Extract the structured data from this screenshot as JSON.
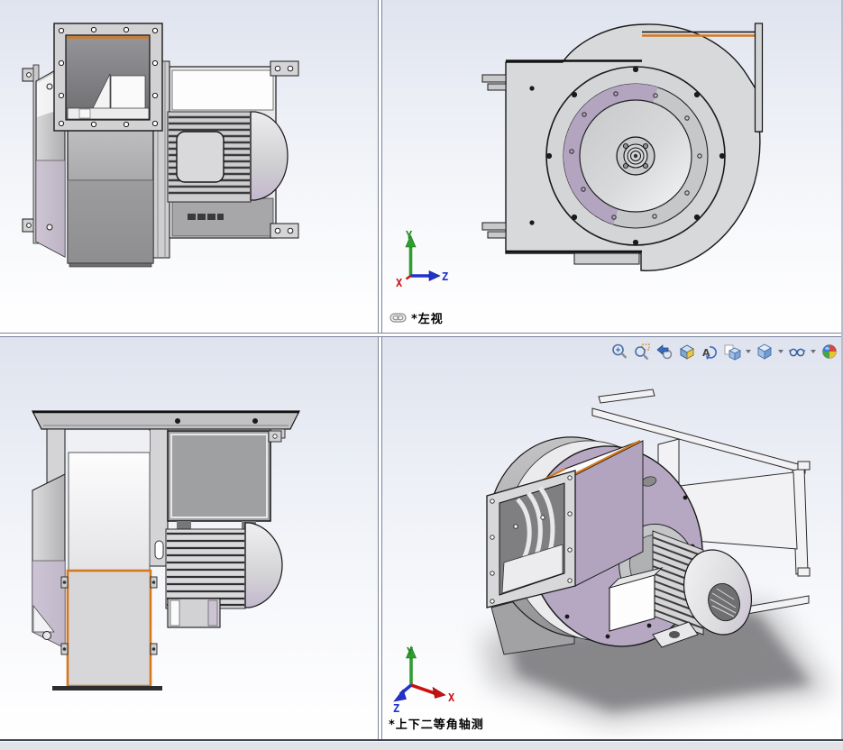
{
  "viewport_labels": {
    "top_right": "*左视",
    "bottom_right": "*上下二等角轴测"
  },
  "triad": {
    "x": "X",
    "y": "Y",
    "z": "Z"
  },
  "toolbar": {
    "items": [
      "zoom-to-fit-icon",
      "zoom-to-area-icon",
      "previous-view-icon",
      "section-view-icon",
      "rotate-view-icon",
      "view-orientation-icon",
      "display-style-icon",
      "hide-show-items-icon",
      "apply-scene-icon"
    ],
    "dropdown_items": [
      "view-orientation-icon",
      "display-style-icon",
      "hide-show-items-icon"
    ]
  },
  "colors": {
    "edge_highlight_orange": "#d4781e",
    "housing_lavender": "#b4a6c1",
    "axis_x_red": "#cc1111",
    "axis_y_green": "#1d8f1d",
    "axis_z_blue": "#2233cc",
    "splitter_blue_gray": "#7d849c"
  }
}
